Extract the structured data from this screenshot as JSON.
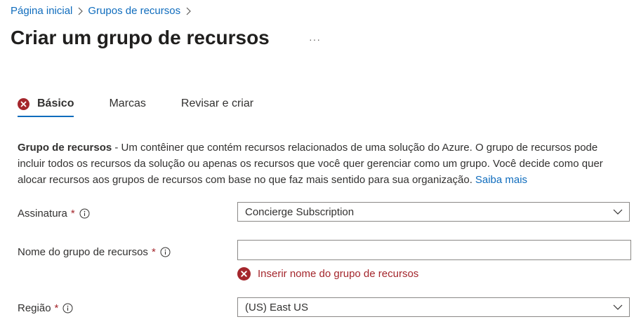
{
  "breadcrumb": {
    "items": [
      "Página inicial",
      "Grupos de recursos"
    ]
  },
  "page": {
    "title": "Criar um grupo de recursos",
    "more": "···"
  },
  "tabs": [
    {
      "label": "Básico",
      "status": "error",
      "selected": true
    },
    {
      "label": "Marcas",
      "selected": false
    },
    {
      "label": "Revisar e criar",
      "selected": false
    }
  ],
  "description": {
    "bold": "Grupo de recursos",
    "text": " - Um contêiner que contém recursos relacionados de uma solução do Azure. O grupo de recursos pode incluir todos os recursos da solução ou apenas os recursos que você quer gerenciar como um grupo. Você decide como quer alocar recursos aos grupos de recursos com base no que faz mais sentido para sua organização.",
    "link": "Saiba mais"
  },
  "form": {
    "subscription": {
      "label": "Assinatura",
      "required": "*",
      "value": "Concierge Subscription"
    },
    "resource_group_name": {
      "label": "Nome do grupo de recursos",
      "required": "*",
      "value": "",
      "error": "Inserir nome do grupo de recursos"
    },
    "region": {
      "label": "Região",
      "required": "*",
      "value": "(US) East US"
    }
  },
  "colors": {
    "link": "#0f6cbd",
    "error": "#a4262c",
    "text": "#323130"
  }
}
